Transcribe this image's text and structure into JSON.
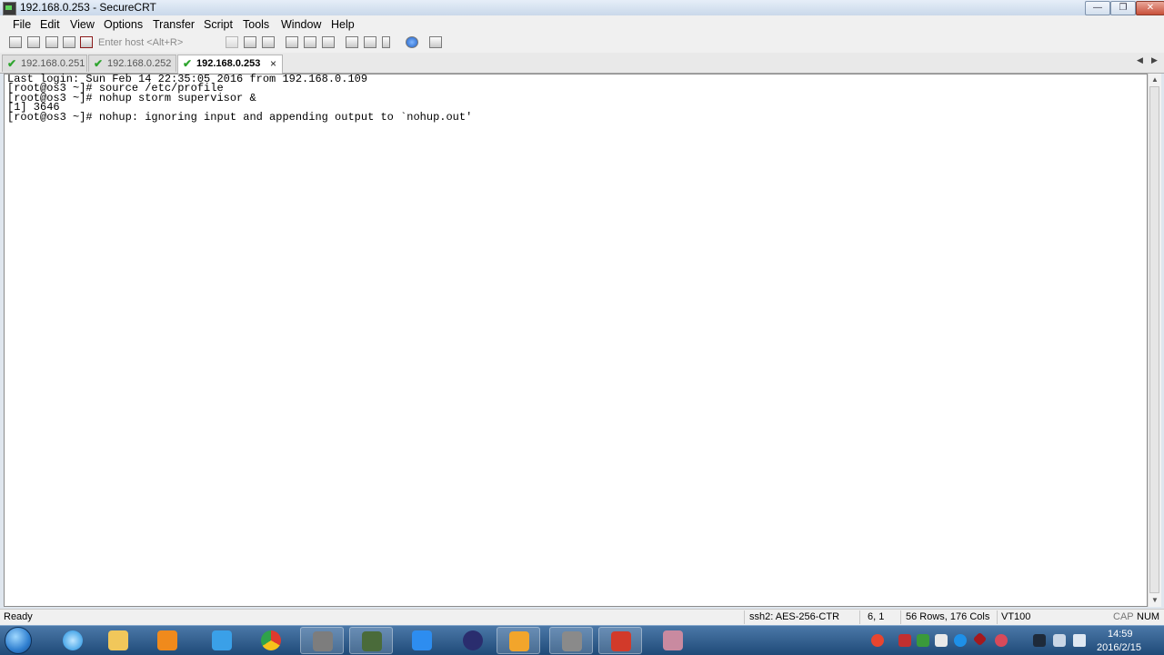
{
  "window": {
    "title": "192.168.0.253 - SecureCRT",
    "minimize_label": "—",
    "maximize_label": "❐",
    "close_label": "✕"
  },
  "menu": [
    "File",
    "Edit",
    "View",
    "Options",
    "Transfer",
    "Script",
    "Tools",
    "Window",
    "Help"
  ],
  "toolbar": {
    "host_placeholder": "Enter host <Alt+R>",
    "icons": [
      "connect-icon",
      "quick-connect-icon",
      "connect-tab-icon",
      "reconnect-icon",
      "disconnect-icon",
      "copy-icon",
      "paste-icon",
      "find-icon",
      "print-icon",
      "print-selection-icon",
      "print-setup-icon",
      "session-options-icon",
      "global-options-icon",
      "keymap-icon",
      "help-icon",
      "sftp-icon"
    ]
  },
  "tabs": [
    {
      "label": "192.168.0.251",
      "active": false
    },
    {
      "label": "192.168.0.252",
      "active": false
    },
    {
      "label": "192.168.0.253",
      "active": true
    }
  ],
  "tab_close_label": "×",
  "tab_nav": {
    "left": "◀",
    "right": "▶"
  },
  "terminal": {
    "lines": [
      "Last login: Sun Feb 14 22:35:05 2016 from 192.168.0.109",
      "[root@os3 ~]# source /etc/profile",
      "[root@os3 ~]# nohup storm supervisor &",
      "[1] 3646",
      "[root@os3 ~]# nohup: ignoring input and appending output to `nohup.out'"
    ]
  },
  "scrollbar": {
    "up": "▲",
    "down": "▼"
  },
  "status": {
    "ready": "Ready",
    "encryption": "ssh2: AES-256-CTR",
    "cursor": "6,   1",
    "size": "56 Rows, 176 Cols",
    "emulation": "VT100",
    "caps": "CAP",
    "num": "NUM"
  },
  "taskbar": {
    "apps": [
      "internet-explorer",
      "file-explorer",
      "media-player",
      "cloud-drive",
      "chrome",
      "securecrt",
      "network-tool",
      "notes-app",
      "eclipse",
      "virtualbox",
      "terminal-app",
      "adobe-reader",
      "pinned-app"
    ],
    "tray": [
      "sogou-ime-icon",
      "tray-app-icon",
      "security-icon",
      "shield-icon",
      "windows-icon",
      "qq-icon",
      "antivirus-icon",
      "flower-icon",
      "input-icon",
      "network-icon",
      "volume-icon"
    ],
    "time": "14:59",
    "date": "2016/2/15"
  },
  "colors": {
    "check": "#2fa52f",
    "taskbar": "#2b5b8c",
    "close_button": "#c8503a"
  }
}
